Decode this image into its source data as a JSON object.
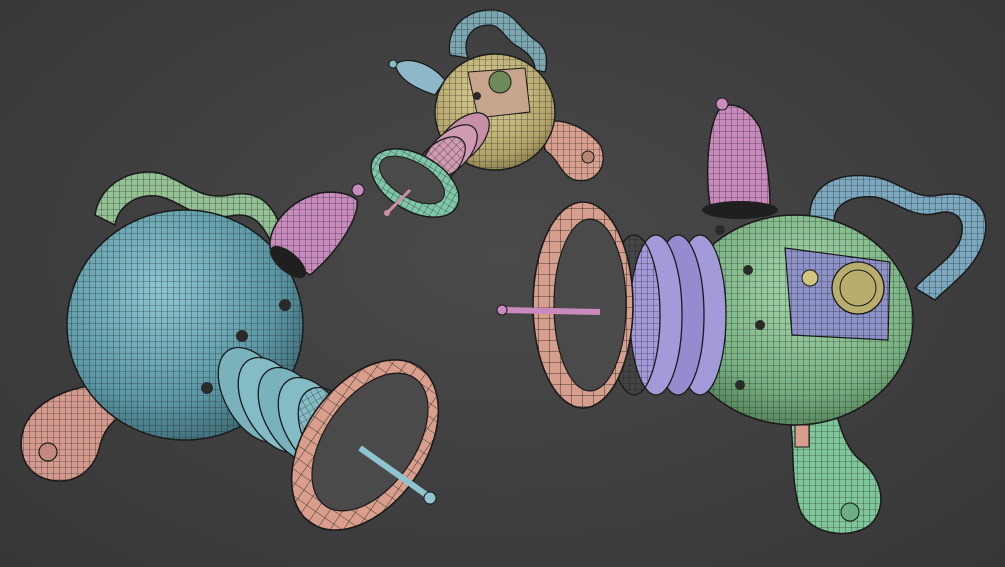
{
  "scene": {
    "background_color": "#3f3f40",
    "wire_color": "#1a1a1a",
    "models": [
      {
        "name": "raygun-blue-left",
        "body_color": "#6aa7b3",
        "handle_color": "#9cc79c",
        "grip_color": "#d79a8e",
        "bell_color": "#d99f8c",
        "nozzle_color": "#c98bbd",
        "coils_color": "#7eb6c0",
        "spike_color": "#8fc5cf"
      },
      {
        "name": "raygun-yellow-top",
        "body_color": "#c4b77a",
        "handle_color": "#7aa7b0",
        "grip_color": "#d9a08f",
        "bell_color": "#7fc7a8",
        "nozzle_color": "#8db8c8",
        "coils_color": "#c78fa8"
      },
      {
        "name": "raygun-green-right",
        "body_color": "#86c08e",
        "handle_color": "#6f9db4",
        "grip_color": "#7fc79b",
        "bell_color": "#d69f8d",
        "nozzle_color": "#c98bbd",
        "coils_color": "#9b8fd6",
        "panel_color": "#8d92c8",
        "spike_color": "#c98bbd"
      }
    ]
  }
}
